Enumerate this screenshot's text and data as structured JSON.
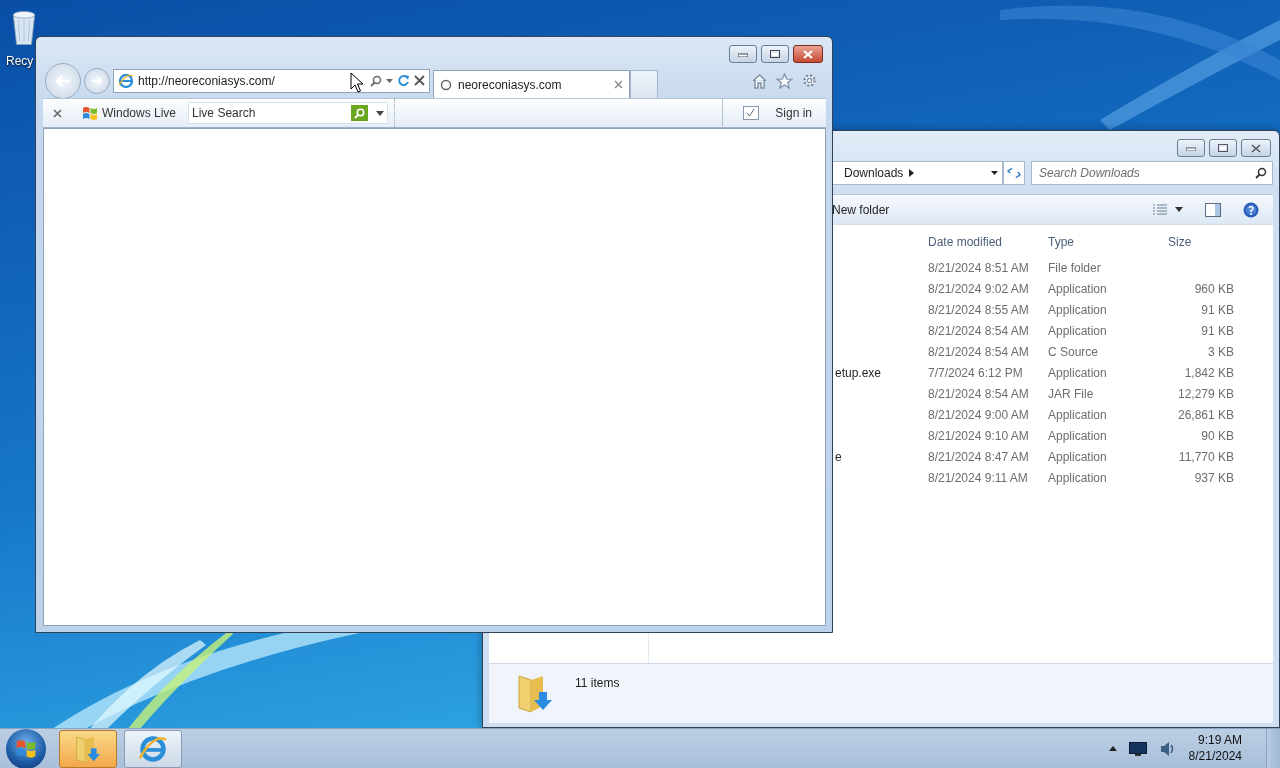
{
  "desktop": {
    "icons": [
      {
        "label": "Recy"
      }
    ]
  },
  "browser": {
    "address": "http://neoreconiasys.com/",
    "tabs": [
      {
        "label": "neoreconiasys.com",
        "selected": true
      }
    ],
    "links_bar": {
      "brand": "Windows Live",
      "search": {
        "placeholder": "Live Search"
      },
      "sign_in": "Sign in"
    }
  },
  "explorer": {
    "breadcrumb": "Downloads",
    "search": {
      "placeholder": "Search Downloads"
    },
    "toolbar": [
      "New folder"
    ],
    "columns": [
      "Date modified",
      "Type",
      "Size"
    ],
    "rows": [
      {
        "date": "8/21/2024 8:51 AM",
        "type": "File folder"
      },
      {
        "date": "8/21/2024 9:02 AM",
        "type": "Application",
        "size": "960 KB"
      },
      {
        "date": "8/21/2024 8:55 AM",
        "type": "Application",
        "size": "91 KB"
      },
      {
        "date": "8/21/2024 8:54 AM",
        "type": "Application",
        "size": "91 KB"
      },
      {
        "date": "8/21/2024 8:54 AM",
        "type": "C Source",
        "size": "3 KB"
      },
      {
        "name": "etup.exe",
        "date": "7/7/2024 6:12 PM",
        "type": "Application",
        "size": "1,842 KB"
      },
      {
        "date": "8/21/2024 8:54 AM",
        "type": "JAR File",
        "size": "12,279 KB"
      },
      {
        "date": "8/21/2024 9:00 AM",
        "type": "Application",
        "size": "26,861 KB"
      },
      {
        "date": "8/21/2024 9:10 AM",
        "type": "Application",
        "size": "90 KB"
      },
      {
        "name": "e",
        "date": "8/21/2024 8:47 AM",
        "type": "Application",
        "size": "11,770 KB"
      },
      {
        "date": "8/21/2024 9:11 AM",
        "type": "Application",
        "size": "937 KB"
      }
    ],
    "status": "11 items"
  },
  "taskbar": {
    "buttons": [
      {
        "kind": "explorer",
        "selected": true
      },
      {
        "kind": "browser",
        "selected": false
      }
    ],
    "clock": {
      "time": "9:19 AM",
      "date": "8/21/2024"
    }
  }
}
